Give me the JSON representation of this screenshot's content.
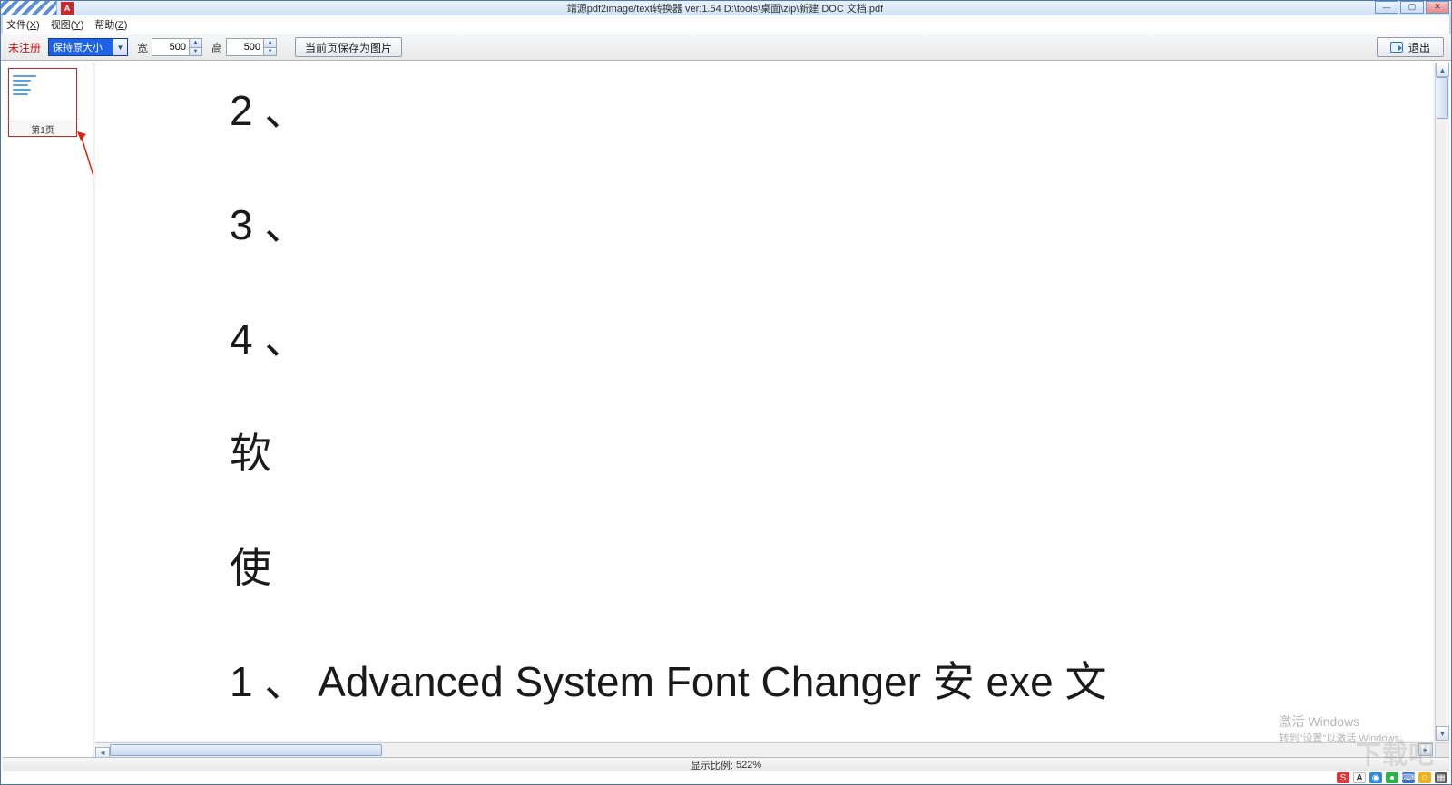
{
  "title": "靖源pdf2image/text转换器 ver:1.54 D:\\tools\\桌面\\zip\\新建 DOC 文档.pdf",
  "app_icon_letter": "A",
  "window_controls": {
    "min": "—",
    "max": "▢",
    "close": "✕"
  },
  "menu": {
    "file": {
      "label": "文件",
      "accel": "X"
    },
    "view": {
      "label": "视图",
      "accel": "Y"
    },
    "help": {
      "label": "帮助",
      "accel": "Z"
    }
  },
  "toolbar": {
    "unregistered": "未注册",
    "zoom_combo": "保持原大小",
    "width_label": "宽",
    "width_value": "500",
    "height_label": "高",
    "height_value": "500",
    "save_btn": "当前页保存为图片",
    "exit_btn": "退出"
  },
  "thumbs": {
    "page1_label": "第1页"
  },
  "document": {
    "lines": {
      "l2": "2 、",
      "l3": "3 、",
      "l4": "4 、",
      "l5": "软",
      "l6": "使",
      "l7": "1 、 Advanced System Font Changer 安 exe 文"
    }
  },
  "status": {
    "zoom_label": "显示比例:",
    "zoom_value": "522%"
  },
  "watermark": {
    "line1": "激活 Windows",
    "line2": "转到\"设置\"以激活 Windows。"
  },
  "tray": {
    "sogou": "S",
    "a": "A",
    "globe": "◉",
    "mic": "●",
    "kb": "⌨",
    "smile": "☺",
    "grid": "▦"
  }
}
